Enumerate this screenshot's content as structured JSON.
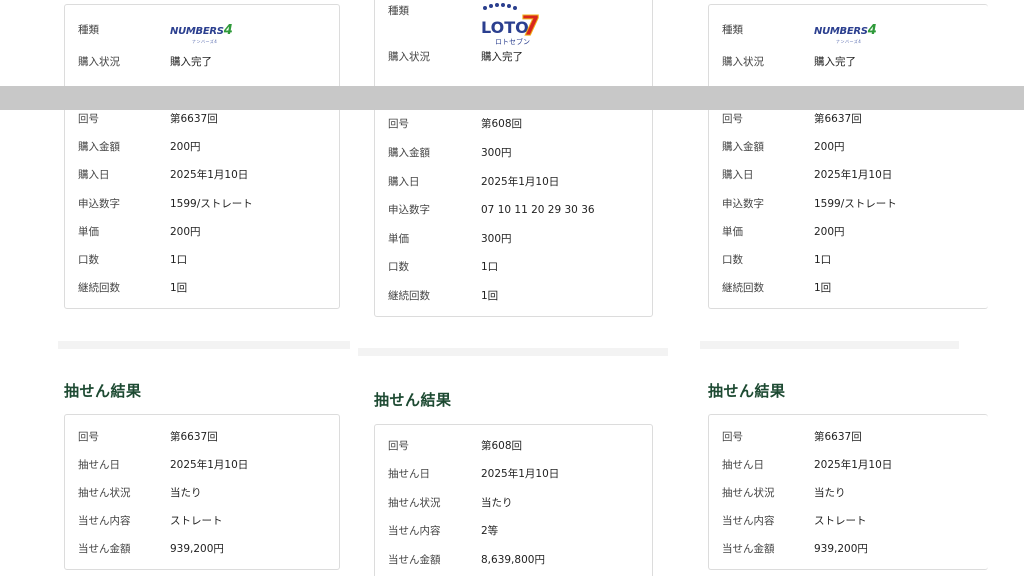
{
  "cards": [
    {
      "logo": "NUMBERS4",
      "logo_sub": "ナンバーズ4",
      "purchase": [
        {
          "label": "種類",
          "value": ""
        },
        {
          "label": "購入状況",
          "value": "購入完了"
        },
        {
          "label": "回号",
          "value": "第6637回"
        },
        {
          "label": "購入金額",
          "value": "200円"
        },
        {
          "label": "購入日",
          "value": "2025年1月10日"
        },
        {
          "label": "申込数字",
          "value": "1599/ストレート"
        },
        {
          "label": "単価",
          "value": "200円"
        },
        {
          "label": "口数",
          "value": "1口"
        },
        {
          "label": "継続回数",
          "value": "1回"
        }
      ],
      "result_title": "抽せん結果",
      "result": [
        {
          "label": "回号",
          "value": "第6637回"
        },
        {
          "label": "抽せん日",
          "value": "2025年1月10日"
        },
        {
          "label": "抽せん状況",
          "value": "当たり"
        },
        {
          "label": "当せん内容",
          "value": "ストレート"
        },
        {
          "label": "当せん金額",
          "value": "939,200円"
        }
      ]
    },
    {
      "logo": "LOTO7",
      "logo_main": "LOTO",
      "logo_seven": "7",
      "logo_sub": "ロトセブン",
      "purchase": [
        {
          "label": "種類",
          "value": ""
        },
        {
          "label": "購入状況",
          "value": "購入完了"
        },
        {
          "label": "回号",
          "value": "第608回"
        },
        {
          "label": "購入金額",
          "value": "300円"
        },
        {
          "label": "購入日",
          "value": "2025年1月10日"
        },
        {
          "label": "申込数字",
          "value": "07 10 11 20 29 30 36"
        },
        {
          "label": "単価",
          "value": "300円"
        },
        {
          "label": "口数",
          "value": "1口"
        },
        {
          "label": "継続回数",
          "value": "1回"
        }
      ],
      "result_title": "抽せん結果",
      "result": [
        {
          "label": "回号",
          "value": "第608回"
        },
        {
          "label": "抽せん日",
          "value": "2025年1月10日"
        },
        {
          "label": "抽せん状況",
          "value": "当たり"
        },
        {
          "label": "当せん内容",
          "value": "2等"
        },
        {
          "label": "当せん金額",
          "value": "8,639,800円"
        }
      ]
    },
    {
      "logo": "NUMBERS4",
      "logo_sub": "ナンバーズ4",
      "purchase": [
        {
          "label": "種類",
          "value": ""
        },
        {
          "label": "購入状況",
          "value": "購入完了"
        },
        {
          "label": "回号",
          "value": "第6637回"
        },
        {
          "label": "購入金額",
          "value": "200円"
        },
        {
          "label": "購入日",
          "value": "2025年1月10日"
        },
        {
          "label": "申込数字",
          "value": "1599/ストレート"
        },
        {
          "label": "単価",
          "value": "200円"
        },
        {
          "label": "口数",
          "value": "1口"
        },
        {
          "label": "継続回数",
          "value": "1回"
        }
      ],
      "result_title": "抽せん結果",
      "result": [
        {
          "label": "回号",
          "value": "第6637回"
        },
        {
          "label": "抽せん日",
          "value": "2025年1月10日"
        },
        {
          "label": "抽せん状況",
          "value": "当たり"
        },
        {
          "label": "当せん内容",
          "value": "ストレート"
        },
        {
          "label": "当せん金額",
          "value": "939,200円"
        }
      ]
    }
  ],
  "colors": {
    "heading": "#1d4a32",
    "numbers_blue": "#2b3f8f",
    "numbers_green": "#2f9a3a",
    "loto_red": "#d8261c",
    "loto_gold": "#f0b21a",
    "overlay_bar": "#c8c8c8"
  }
}
